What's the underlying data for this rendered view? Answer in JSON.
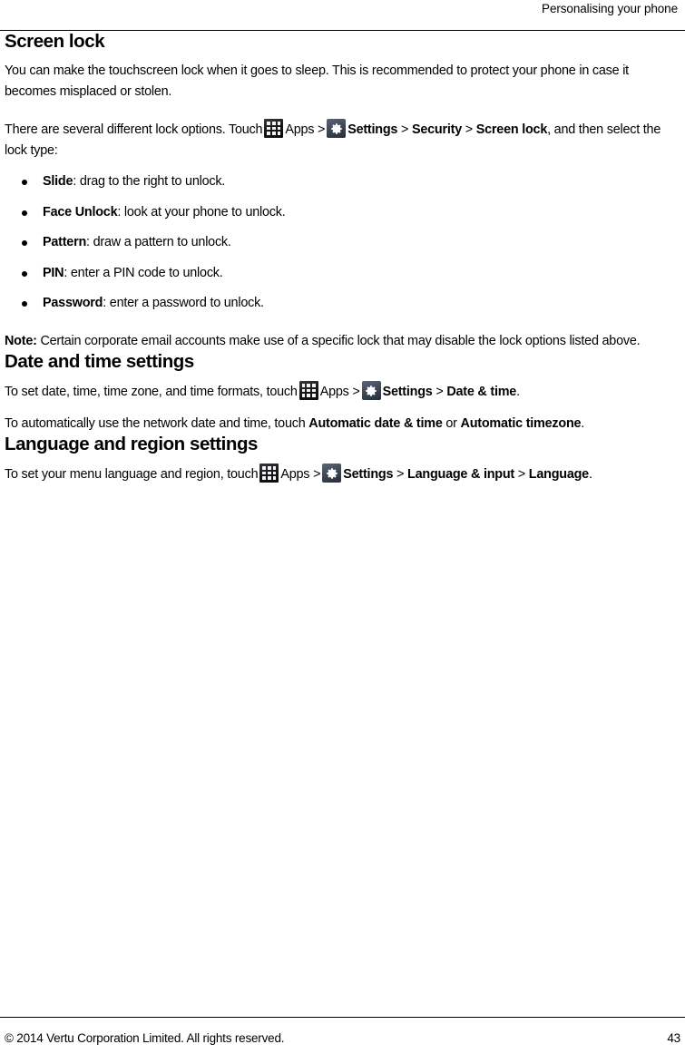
{
  "header": {
    "running_title": "Personalising your phone"
  },
  "sections": [
    {
      "id": "screen-lock",
      "title": "Screen lock",
      "intro": "You can make the touchscreen lock when it goes to sleep. This is recommended to protect your phone in case it becomes misplaced or stolen.",
      "path_intro": "There are several different lock options. Touch",
      "apps_label": "Apps",
      "settings_label": "Settings",
      "crumb_security": "Security",
      "crumb_screen_lock": "Screen lock",
      "path_tail": ", and then select the lock type:",
      "separator": ">",
      "bullets": [
        {
          "term": "Slide",
          "desc": ": drag to the right to unlock."
        },
        {
          "term": "Face Unlock",
          "desc": ": look at your phone to unlock."
        },
        {
          "term": "Pattern",
          "desc": ": draw a pattern to unlock."
        },
        {
          "term": "PIN",
          "desc": ": enter a PIN code to unlock."
        },
        {
          "term": "Password",
          "desc": ": enter a password to unlock."
        }
      ],
      "note_label": "Note:",
      "note_text": " Certain corporate email accounts make use of a specific lock that may disable the lock options listed above."
    },
    {
      "id": "date-time",
      "title": "Date and time settings",
      "line1_pre": "To set date, time, time zone, and time formats, touch",
      "apps_label": "Apps",
      "settings_label": "Settings",
      "crumb_date_time": "Date & time",
      "line1_tail": ".",
      "line2_pre": "To automatically use the network date and time, touch",
      "auto_date_time": "Automatic date & time",
      "line2_mid": " or ",
      "auto_timezone": "Automatic timezone",
      "line2_tail": ".",
      "separator": ">"
    },
    {
      "id": "language",
      "title": "Language and region settings",
      "line1_pre": "To set your menu language and region, touch",
      "apps_label": "Apps",
      "settings_label": "Settings",
      "crumb_language_input": "Language & input",
      "crumb_language": "Language",
      "line1_tail": ".",
      "separator": ">"
    }
  ],
  "icons": {
    "apps": "apps-grid-icon",
    "settings": "gear-icon"
  },
  "footer": {
    "copyright": "© 2014 Vertu Corporation Limited. All rights reserved.",
    "page_number": "43"
  },
  "colors": {
    "text": "#000000",
    "rule": "#000000",
    "apps_icon_bg": "#161618",
    "settings_icon_bg": "#3b4553",
    "page_bg": "#ffffff"
  }
}
